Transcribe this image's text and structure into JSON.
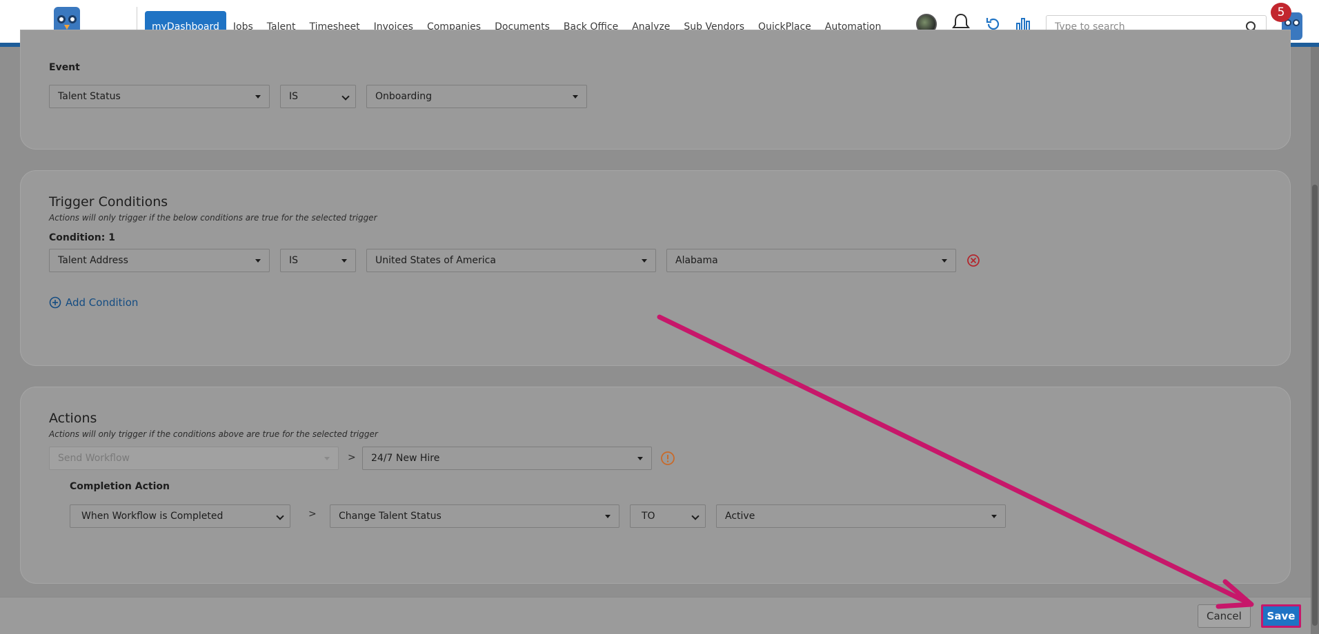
{
  "nav": {
    "items": [
      "myDashboard",
      "Jobs",
      "Talent",
      "Timesheet",
      "Invoices",
      "Companies",
      "Documents",
      "Back Office",
      "Analyze",
      "Sub Vendors",
      "QuickPlace",
      "Automation"
    ],
    "active_index": 0
  },
  "header": {
    "search_placeholder": "Type to search",
    "notification_count": "5"
  },
  "event": {
    "label": "Event",
    "field": "Talent Status",
    "operator": "IS",
    "value": "Onboarding"
  },
  "trigger": {
    "title": "Trigger Conditions",
    "subtitle": "Actions will only trigger if the below conditions are true for the selected trigger",
    "condition_label": "Condition: 1",
    "field": "Talent Address",
    "operator": "IS",
    "country": "United States of America",
    "state": "Alabama",
    "add_condition": "Add Condition"
  },
  "actions": {
    "title": "Actions",
    "subtitle": "Actions will only trigger if the conditions above are true for the selected trigger",
    "action_type": "Send Workflow",
    "separator": ">",
    "workflow": "24/7 New Hire",
    "completion_label": "Completion Action",
    "completion_when": "When Workflow is Completed",
    "completion_action": "Change Talent Status",
    "completion_operator": "TO",
    "completion_value": "Active"
  },
  "footer": {
    "cancel_label": "Cancel",
    "save_label": "Save"
  },
  "colors": {
    "brand": "#1f73c4",
    "highlight": "#c7176a",
    "badge": "#c2262e"
  }
}
